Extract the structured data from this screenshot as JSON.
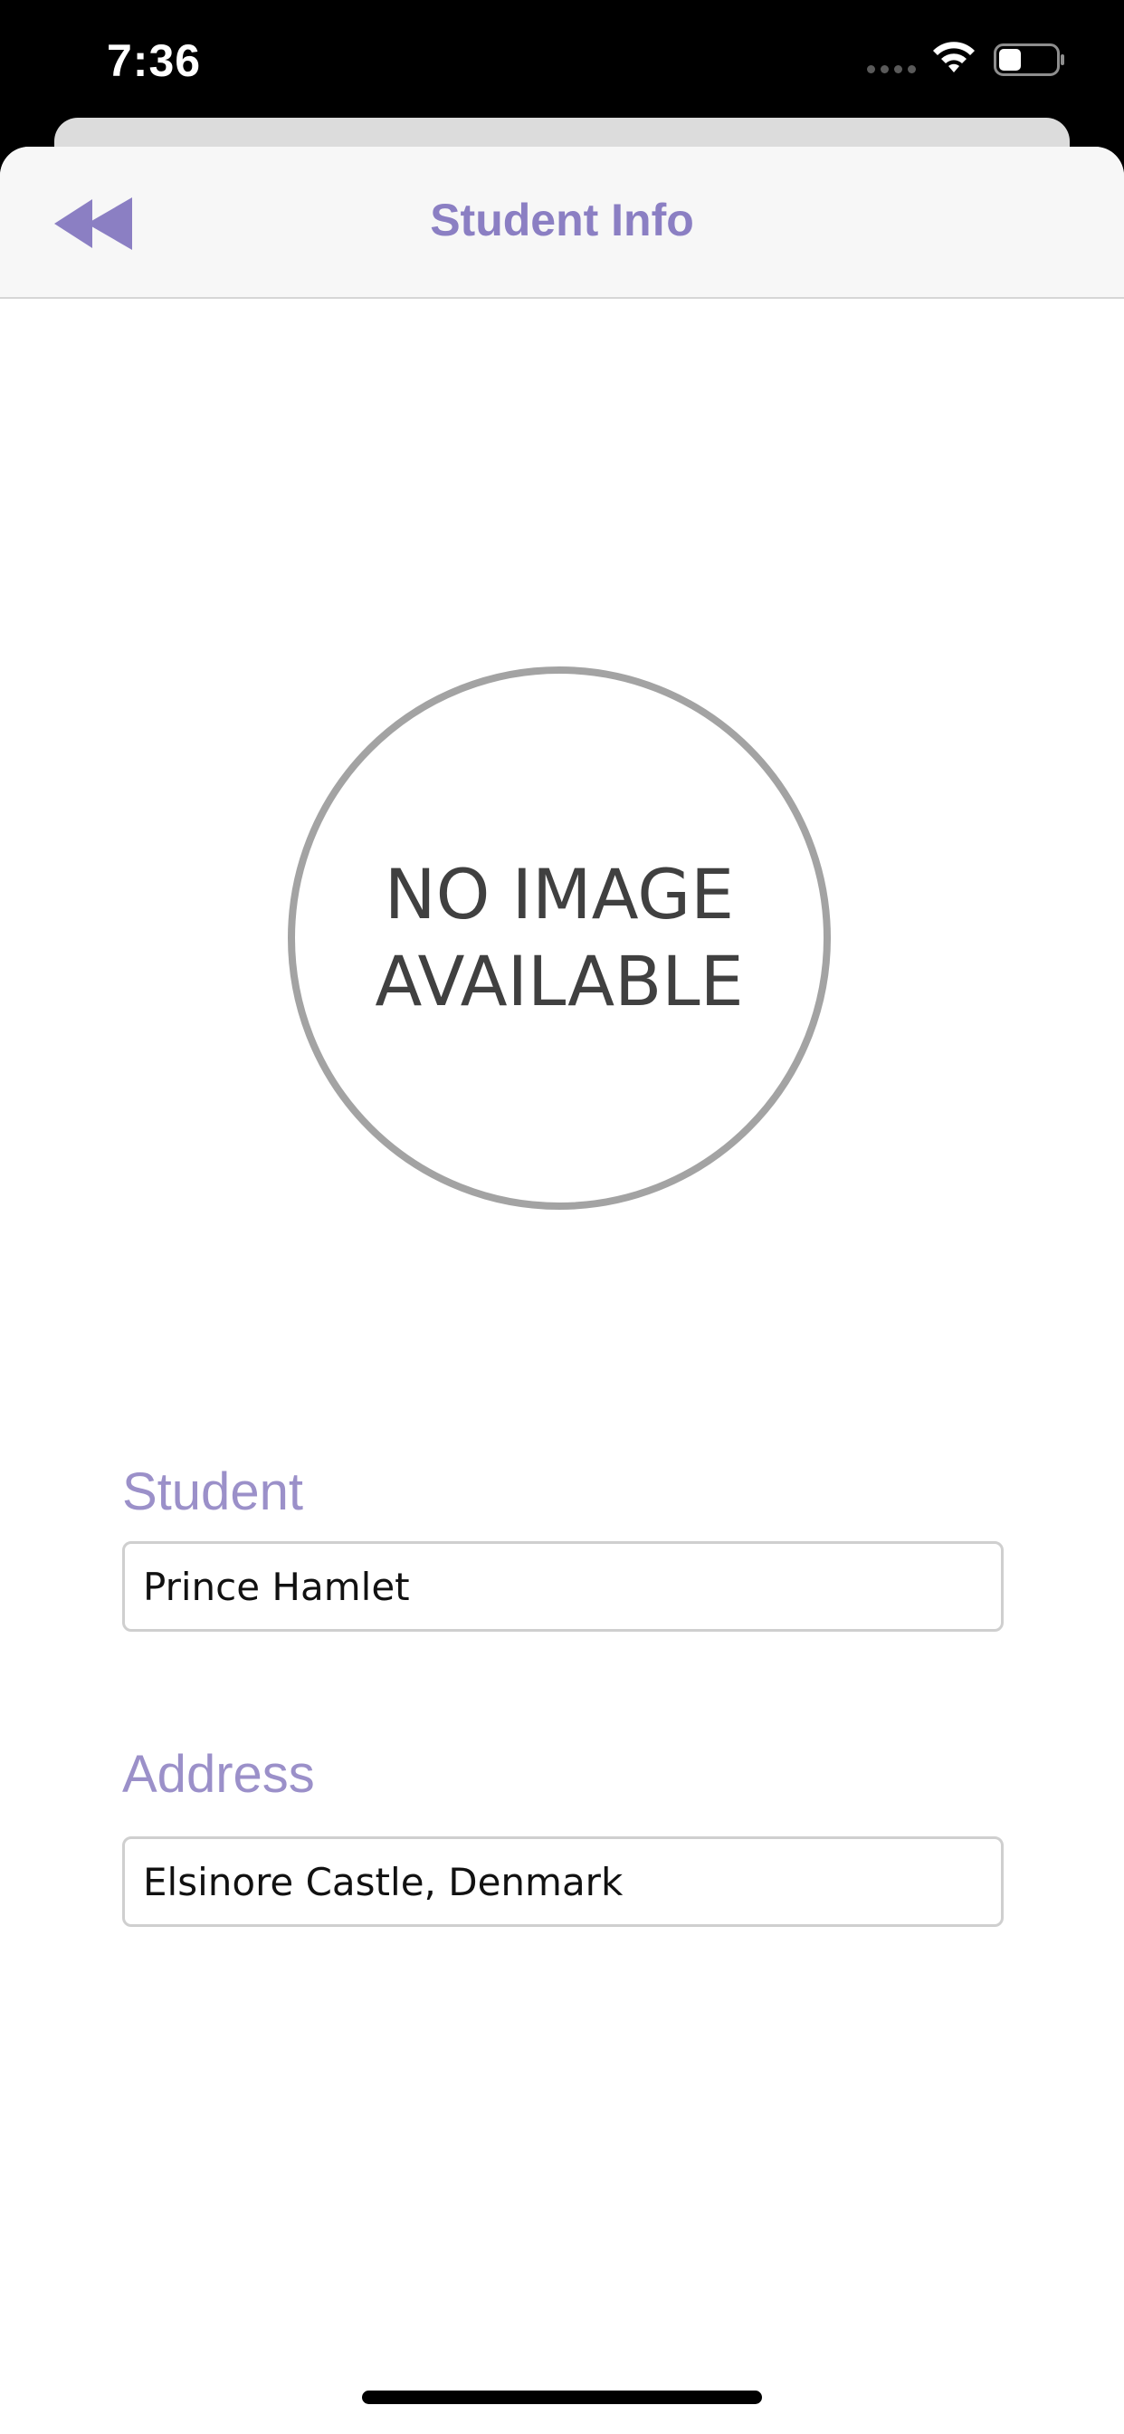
{
  "status_bar": {
    "time": "7:36",
    "icons": [
      "signal-dots-icon",
      "wifi-icon",
      "battery-icon"
    ]
  },
  "nav": {
    "title": "Student Info",
    "back_icon": "rewind-icon"
  },
  "photo": {
    "placeholder_text": "NO IMAGE\nAVAILABLE"
  },
  "form": {
    "student_label": "Student",
    "student_value": "Prince Hamlet",
    "address_label": "Address",
    "address_value": "Elsinore Castle, Denmark"
  },
  "colors": {
    "accent": "#8b7fc3",
    "label": "#9b90c9",
    "placeholder_border": "#a3a3a3"
  }
}
